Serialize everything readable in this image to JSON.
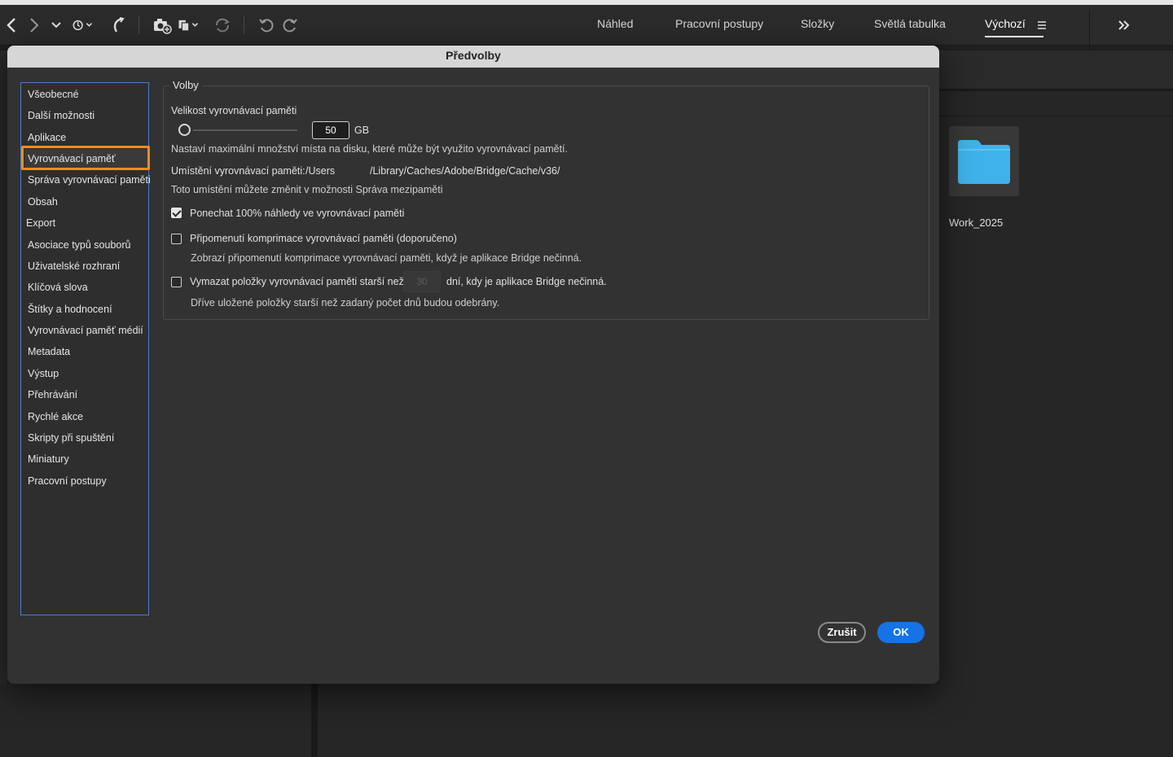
{
  "toolbar": {
    "workspace_tabs": [
      "Náhled",
      "Pracovní postupy",
      "Složky",
      "Světlá tabulka",
      "Výchozí"
    ],
    "active_tab": "Výchozí"
  },
  "background": {
    "folder_name": "Work_2025"
  },
  "dialog": {
    "title": "Předvolby",
    "categories": [
      "Všeobecné",
      "Další možnosti",
      "Aplikace",
      "Vyrovnávací paměť",
      "Správa vyrovnávací paměti",
      "Obsah",
      "Export",
      "Asociace typů souborů",
      "Uživatelské rozhraní",
      "Klíčová slova",
      "Štítky a hodnocení",
      "Vyrovnávací paměť médií",
      "Metadata",
      "Výstup",
      "Přehrávání",
      "Rychlé akce",
      "Skripty při spuštění",
      "Miniatury",
      "Pracovní postupy"
    ],
    "selected_category": "Vyrovnávací paměť",
    "group_label": "Volby",
    "cache_size_label": "Velikost vyrovnávací paměti",
    "cache_size_value": "50",
    "cache_size_unit": "GB",
    "cache_size_help": "Nastaví maximální množství místa na disku, které může být využito vyrovnávací pamětí.",
    "location_label": "Umístění vyrovnávací paměti:",
    "location_path_prefix": "/Users",
    "location_path_suffix": "/Library/Caches/Adobe/Bridge/Cache/v36/",
    "location_help": "Toto umístění můžete změnit v možnosti Správa mezipaměti",
    "keep_previews_label": "Ponechat 100% náhledy ve vyrovnávací paměti",
    "keep_previews_checked": true,
    "compact_reminder_label": "Připomenutí komprimace vyrovnávací paměti (doporučeno)",
    "compact_reminder_checked": false,
    "compact_reminder_help": "Zobrazí připomenutí komprimace vyrovnávací paměti, když je aplikace Bridge nečinná.",
    "purge_label_before": "Vymazat položky vyrovnávací paměti starší než",
    "purge_days_value": "30",
    "purge_label_after": "dní, kdy je aplikace Bridge nečinná.",
    "purge_checked": false,
    "purge_help": "Dříve uložené položky starší než zadaný počet dnů budou odebrány.",
    "cancel_label": "Zrušit",
    "ok_label": "OK"
  },
  "colors": {
    "accent": "#1473e6",
    "highlight": "#f28c1e",
    "folder": "#3fb2ea"
  }
}
